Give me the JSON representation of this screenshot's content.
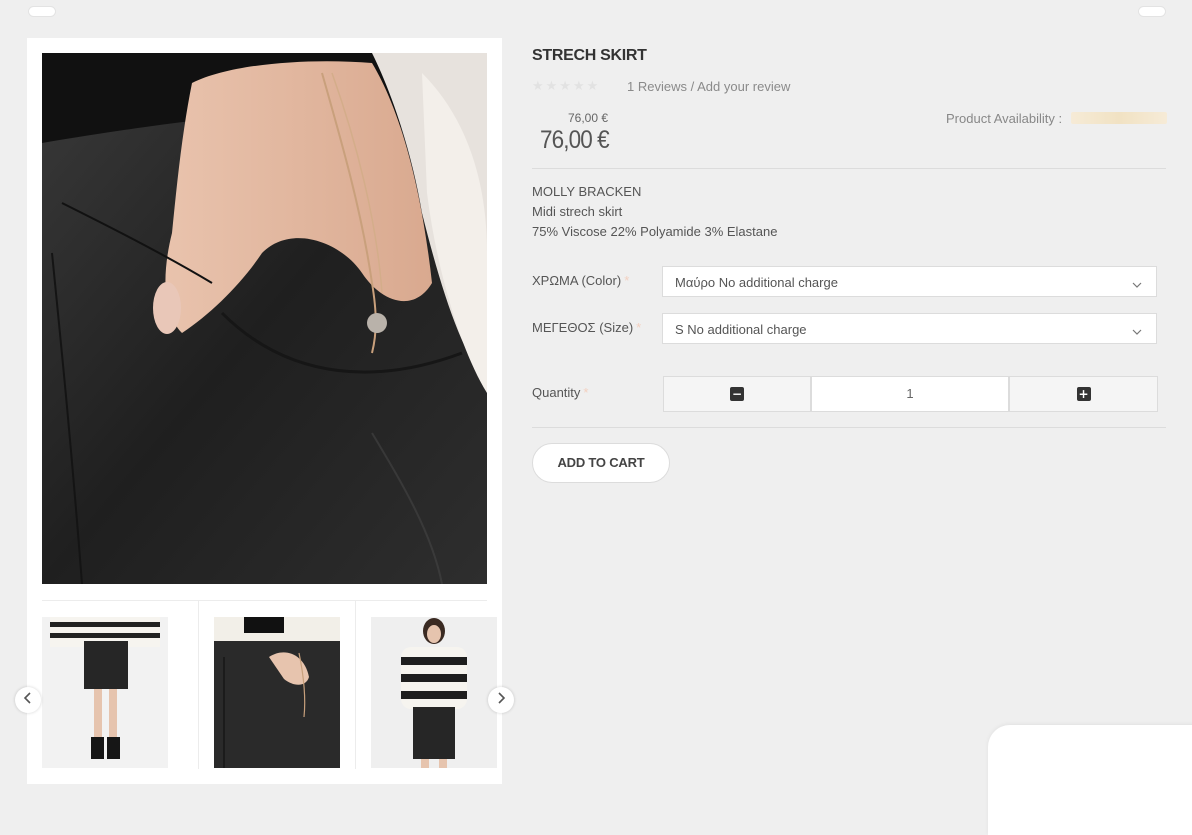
{
  "product": {
    "title": "STRECH SKIRT",
    "rating_stars": "★★★★★",
    "reviews_count": "1 Reviews",
    "reviews_sep": "/",
    "add_review": "Add your review",
    "old_price": "76,00 €",
    "price": "76,00 €",
    "availability_label": "Product Availability :",
    "description": [
      "MOLLY BRACKEN",
      "Midi strech skirt",
      "75% Viscose 22% Polyamide 3% Elastane"
    ]
  },
  "options": {
    "color": {
      "label": "ΧΡΩΜΑ (Color)",
      "required_mark": "*",
      "value": "Μαύρο No additional charge"
    },
    "size": {
      "label": "ΜΕΓΕΘΟΣ (Size)",
      "required_mark": "*",
      "value": "S No additional charge"
    }
  },
  "quantity": {
    "label": "Quantity",
    "required_mark": "*",
    "value": "1",
    "minus": "−",
    "plus": "+"
  },
  "cart": {
    "add_label": "ADD TO CART"
  },
  "icons": {
    "prev": "chevron-left-icon",
    "next": "chevron-right-icon",
    "dropdown": "chevron-down-icon"
  },
  "colors": {
    "background": "#efefef",
    "accent": "#333333",
    "availability_bar": "#f1e2c3"
  }
}
